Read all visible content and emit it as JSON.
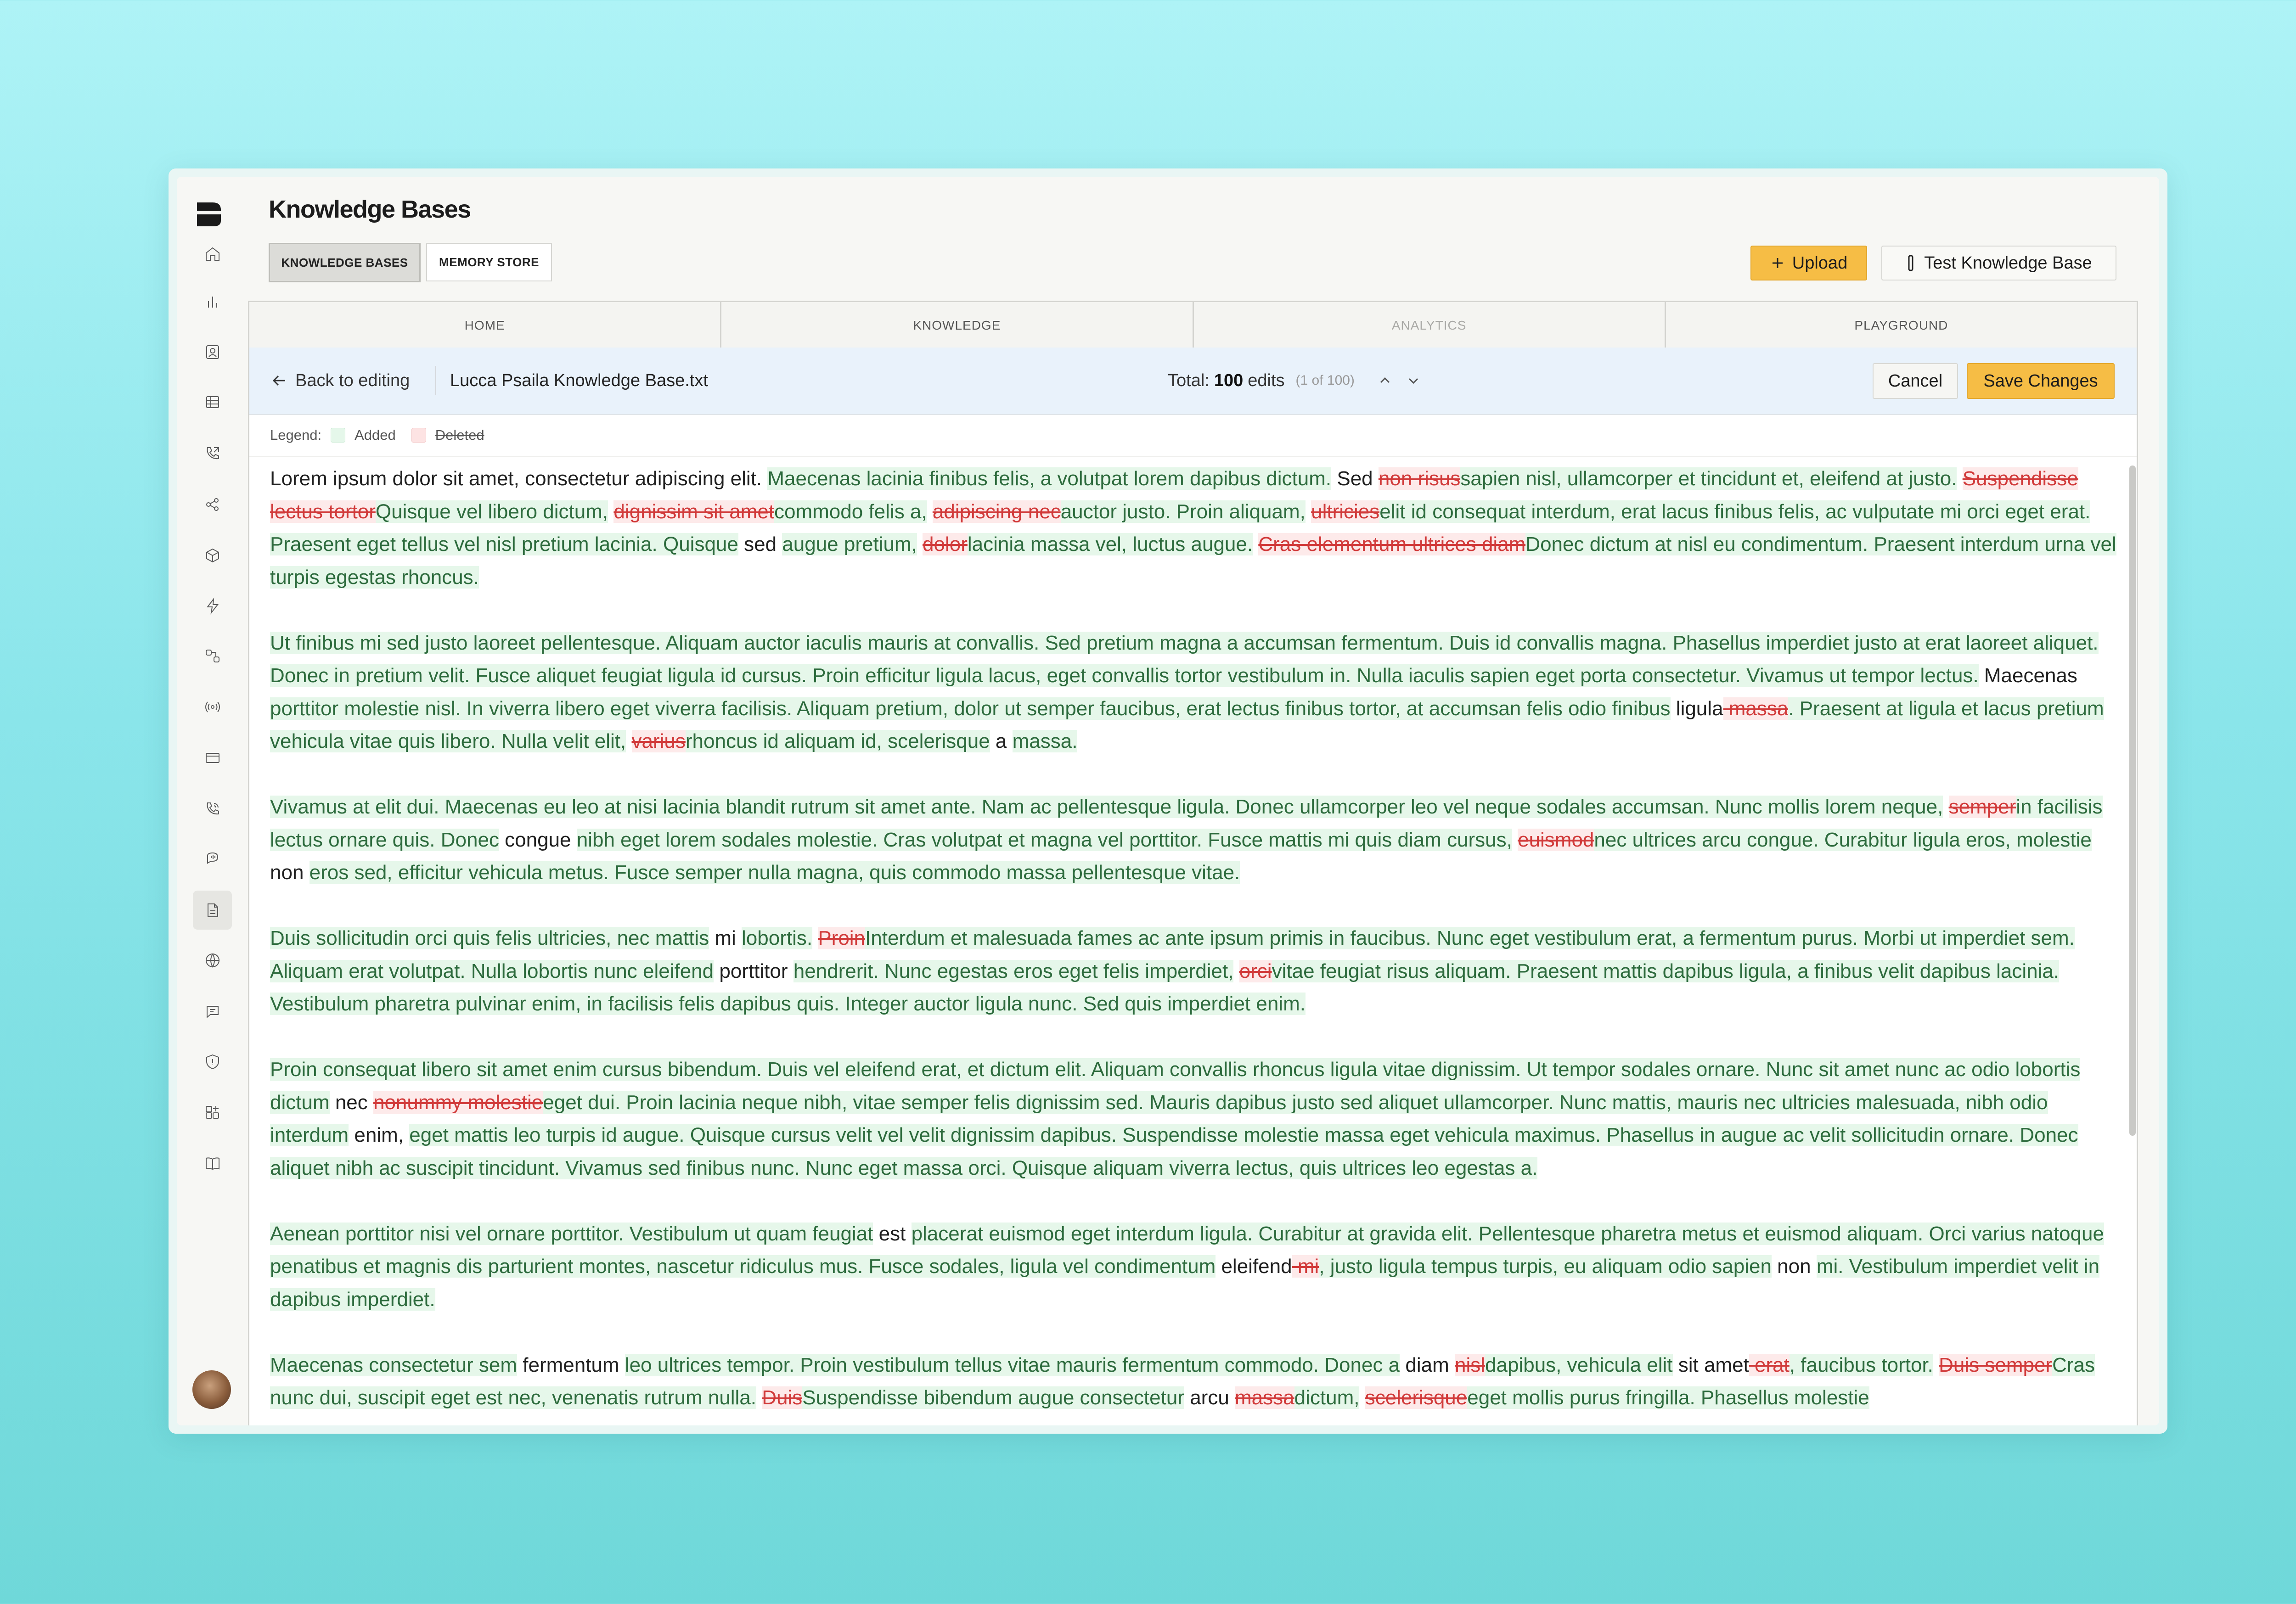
{
  "app": {
    "title": "Knowledge Bases",
    "segments": [
      "KNOWLEDGE BASES",
      "MEMORY STORE"
    ],
    "upload_label": "Upload",
    "test_label": "Test Knowledge Base"
  },
  "tabs": [
    "HOME",
    "KNOWLEDGE",
    "ANALYTICS",
    "PLAYGROUND"
  ],
  "toolbar": {
    "back_label": "Back to editing",
    "file_name": "Lucca Psaila Knowledge Base.txt",
    "total_prefix": "Total:",
    "total_count": "100",
    "total_suffix": "edits",
    "position": "(1 of 100)",
    "cancel_label": "Cancel",
    "save_label": "Save Changes"
  },
  "legend": {
    "label": "Legend:",
    "added": "Added",
    "deleted": "Deleted"
  },
  "colors": {
    "accent": "#f6bd45",
    "added_bg": "#e6f7ea",
    "added_text": "#2d6b3d",
    "deleted_text": "#d13a3a"
  },
  "sidebar_icons": [
    "home-icon",
    "bar-chart-icon",
    "contact-icon",
    "table-icon",
    "phone-forward-icon",
    "share-icon",
    "package-icon",
    "bolt-icon",
    "workflow-icon",
    "broadcast-icon",
    "card-icon",
    "phone-icon",
    "chat-voice-icon",
    "document-icon",
    "globe-icon",
    "message-icon",
    "shield-icon",
    "apps-icon",
    "book-icon"
  ],
  "paragraphs": [
    [
      {
        "t": "n",
        "s": "Lorem ipsum dolor sit amet, consectetur adipiscing elit. "
      },
      {
        "t": "a",
        "s": "Maecenas lacinia finibus felis, a volutpat lorem dapibus dictum."
      },
      {
        "t": "n",
        "s": " Sed "
      },
      {
        "t": "d",
        "s": "non risus"
      },
      {
        "t": "a",
        "s": "sapien nisl, ullamcorper et tincidunt et, eleifend at justo."
      },
      {
        "t": "n",
        "s": " "
      },
      {
        "t": "d",
        "s": "Suspendisse lectus tortor"
      },
      {
        "t": "a",
        "s": "Quisque vel libero dictum,"
      },
      {
        "t": "n",
        "s": " "
      },
      {
        "t": "d",
        "s": "dignissim sit amet"
      },
      {
        "t": "a",
        "s": "commodo felis a,"
      },
      {
        "t": "n",
        "s": " "
      },
      {
        "t": "d",
        "s": "adipiscing nec"
      },
      {
        "t": "a",
        "s": "auctor justo. Proin aliquam,"
      },
      {
        "t": "n",
        "s": " "
      },
      {
        "t": "d",
        "s": "ultricies"
      },
      {
        "t": "a",
        "s": "elit id consequat interdum, erat lacus finibus felis, ac vulputate mi orci eget erat. Praesent eget tellus vel nisl pretium lacinia. Quisque"
      },
      {
        "t": "n",
        "s": " sed "
      },
      {
        "t": "a",
        "s": "augue pretium,"
      },
      {
        "t": "n",
        "s": " "
      },
      {
        "t": "d",
        "s": "dolor"
      },
      {
        "t": "a",
        "s": "lacinia massa vel, luctus augue."
      },
      {
        "t": "n",
        "s": " "
      },
      {
        "t": "d",
        "s": "Cras elementum ultrices diam"
      },
      {
        "t": "a",
        "s": "Donec dictum at nisl eu condimentum. Praesent interdum urna vel turpis egestas rhoncus."
      }
    ],
    [
      {
        "t": "a",
        "s": "Ut finibus mi sed justo laoreet pellentesque. Aliquam auctor iaculis mauris at convallis. Sed pretium magna a accumsan fermentum. Duis id convallis magna. Phasellus imperdiet justo at erat laoreet aliquet. Donec in pretium velit. Fusce aliquet feugiat ligula id cursus. Proin efficitur ligula lacus, eget convallis tortor vestibulum in. Nulla iaculis sapien eget porta consectetur. Vivamus ut tempor lectus."
      },
      {
        "t": "n",
        "s": " Maecenas "
      },
      {
        "t": "a",
        "s": "porttitor molestie nisl. In viverra libero eget viverra facilisis. Aliquam pretium, dolor ut semper faucibus, erat lectus finibus tortor, at accumsan felis odio finibus"
      },
      {
        "t": "n",
        "s": " ligula"
      },
      {
        "t": "d",
        "s": " massa"
      },
      {
        "t": "a",
        "s": ". Praesent at ligula et lacus pretium vehicula vitae quis libero. Nulla velit elit,"
      },
      {
        "t": "n",
        "s": " "
      },
      {
        "t": "d",
        "s": "varius"
      },
      {
        "t": "a",
        "s": "rhoncus id aliquam id, scelerisque"
      },
      {
        "t": "n",
        "s": " a "
      },
      {
        "t": "a",
        "s": "massa."
      }
    ],
    [
      {
        "t": "a",
        "s": "Vivamus at elit dui. Maecenas eu leo at nisi lacinia blandit rutrum sit amet ante. Nam ac pellentesque ligula. Donec ullamcorper leo vel neque sodales accumsan. Nunc mollis lorem neque,"
      },
      {
        "t": "n",
        "s": " "
      },
      {
        "t": "d",
        "s": "semper"
      },
      {
        "t": "a",
        "s": "in facilisis lectus ornare quis. Donec"
      },
      {
        "t": "n",
        "s": " congue "
      },
      {
        "t": "a",
        "s": "nibh eget lorem sodales molestie. Cras volutpat et magna vel porttitor. Fusce mattis mi quis diam cursus,"
      },
      {
        "t": "n",
        "s": " "
      },
      {
        "t": "d",
        "s": "euismod"
      },
      {
        "t": "a",
        "s": "nec ultrices arcu congue. Curabitur ligula eros, molestie"
      },
      {
        "t": "n",
        "s": " non "
      },
      {
        "t": "a",
        "s": "eros sed, efficitur vehicula metus. Fusce semper nulla magna, quis commodo massa pellentesque vitae."
      }
    ],
    [
      {
        "t": "a",
        "s": "Duis sollicitudin orci quis felis ultricies, nec mattis"
      },
      {
        "t": "n",
        "s": " mi "
      },
      {
        "t": "a",
        "s": "lobortis."
      },
      {
        "t": "n",
        "s": " "
      },
      {
        "t": "d",
        "s": "Proin"
      },
      {
        "t": "a",
        "s": "Interdum et malesuada fames ac ante ipsum primis in faucibus. Nunc eget vestibulum erat, a fermentum purus. Morbi ut imperdiet sem. Aliquam erat volutpat. Nulla lobortis nunc eleifend"
      },
      {
        "t": "n",
        "s": " porttitor "
      },
      {
        "t": "a",
        "s": "hendrerit. Nunc egestas eros eget felis imperdiet,"
      },
      {
        "t": "n",
        "s": " "
      },
      {
        "t": "d",
        "s": "orci"
      },
      {
        "t": "a",
        "s": "vitae feugiat risus aliquam. Praesent mattis dapibus ligula, a finibus velit dapibus lacinia. Vestibulum pharetra pulvinar enim, in facilisis felis dapibus quis. Integer auctor ligula nunc. Sed quis imperdiet enim."
      }
    ],
    [
      {
        "t": "a",
        "s": "Proin consequat libero sit amet enim cursus bibendum. Duis vel eleifend erat, et dictum elit. Aliquam convallis rhoncus ligula vitae dignissim. Ut tempor sodales ornare. Nunc sit amet nunc ac odio lobortis dictum"
      },
      {
        "t": "n",
        "s": " nec "
      },
      {
        "t": "d",
        "s": "nonummy molestie"
      },
      {
        "t": "a",
        "s": "eget dui. Proin lacinia neque nibh, vitae semper felis dignissim sed. Mauris dapibus justo sed aliquet ullamcorper. Nunc mattis, mauris nec ultricies malesuada, nibh odio interdum"
      },
      {
        "t": "n",
        "s": " enim, "
      },
      {
        "t": "a",
        "s": "eget mattis leo turpis id augue. Quisque cursus velit vel velit dignissim dapibus. Suspendisse molestie massa eget vehicula maximus. Phasellus in augue ac velit sollicitudin ornare. Donec aliquet nibh ac suscipit tincidunt. Vivamus sed finibus nunc. Nunc eget massa orci. Quisque aliquam viverra lectus, quis ultrices leo egestas a."
      }
    ],
    [
      {
        "t": "a",
        "s": "Aenean porttitor nisi vel ornare porttitor. Vestibulum ut quam feugiat"
      },
      {
        "t": "n",
        "s": " est "
      },
      {
        "t": "a",
        "s": "placerat euismod eget interdum ligula. Curabitur at gravida elit. Pellentesque pharetra metus et euismod aliquam. Orci varius natoque penatibus et magnis dis parturient montes, nascetur ridiculus mus. Fusce sodales, ligula vel condimentum"
      },
      {
        "t": "n",
        "s": " eleifend"
      },
      {
        "t": "d",
        "s": " mi"
      },
      {
        "t": "a",
        "s": ", justo ligula tempus turpis, eu aliquam odio sapien"
      },
      {
        "t": "n",
        "s": " non "
      },
      {
        "t": "a",
        "s": "mi. Vestibulum imperdiet velit in dapibus imperdiet."
      }
    ],
    [
      {
        "t": "a",
        "s": "Maecenas consectetur sem"
      },
      {
        "t": "n",
        "s": " fermentum "
      },
      {
        "t": "a",
        "s": "leo ultrices tempor. Proin vestibulum tellus vitae mauris fermentum commodo. Donec a"
      },
      {
        "t": "n",
        "s": " diam "
      },
      {
        "t": "d",
        "s": "nisl"
      },
      {
        "t": "a",
        "s": "dapibus, vehicula elit"
      },
      {
        "t": "n",
        "s": " sit amet"
      },
      {
        "t": "d",
        "s": " erat"
      },
      {
        "t": "a",
        "s": ", faucibus tortor."
      },
      {
        "t": "n",
        "s": " "
      },
      {
        "t": "d",
        "s": "Duis semper"
      },
      {
        "t": "a",
        "s": "Cras nunc dui, suscipit eget est nec, venenatis rutrum nulla."
      },
      {
        "t": "n",
        "s": " "
      },
      {
        "t": "d",
        "s": "Duis"
      },
      {
        "t": "a",
        "s": "Suspendisse bibendum augue consectetur"
      },
      {
        "t": "n",
        "s": " arcu "
      },
      {
        "t": "d",
        "s": "massa"
      },
      {
        "t": "a",
        "s": "dictum,"
      },
      {
        "t": "n",
        "s": " "
      },
      {
        "t": "d",
        "s": "scelerisque"
      },
      {
        "t": "a",
        "s": "eget mollis purus fringilla. Phasellus molestie"
      }
    ]
  ]
}
